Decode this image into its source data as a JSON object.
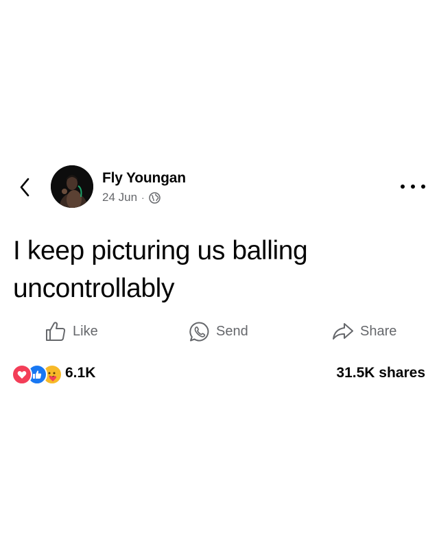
{
  "post": {
    "author": "Fly Youngan",
    "date": "24 Jun",
    "separator": "·",
    "audience_icon": "globe-icon",
    "text": "I keep picturing us balling uncontrollably"
  },
  "actions": {
    "like_label": "Like",
    "send_label": "Send",
    "share_label": "Share"
  },
  "stats": {
    "reaction_count": "6.1K",
    "shares": "31.5K shares",
    "reaction_icons": [
      "love-icon",
      "like-icon",
      "care-icon"
    ]
  },
  "colors": {
    "text_primary": "#050505",
    "text_secondary": "#65676b",
    "like_blue": "#1877f2",
    "love_red": "#f33e58",
    "care_yellow": "#f7b928"
  }
}
